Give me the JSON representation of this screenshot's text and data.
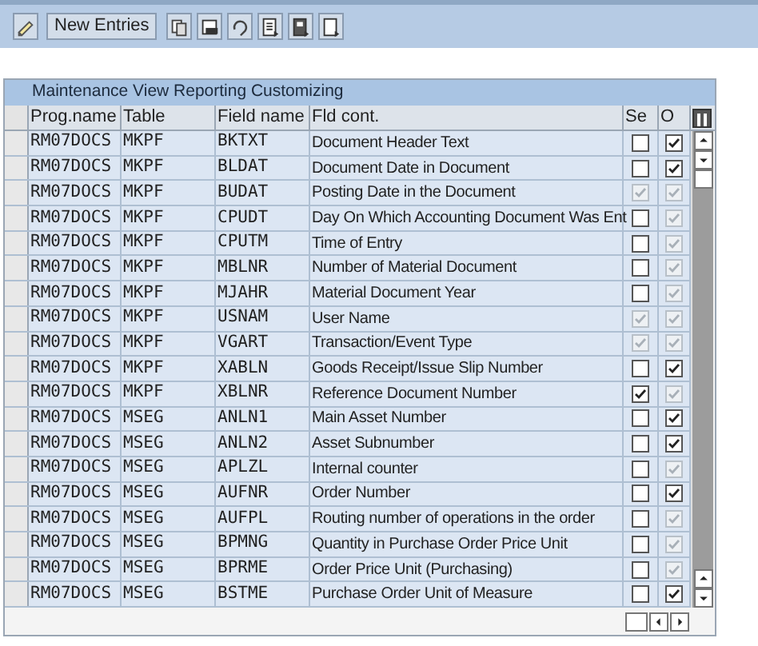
{
  "toolbar": {
    "new_entries_button": "New Entries"
  },
  "table": {
    "title": "Maintenance View Reporting Customizing",
    "columns": [
      "Prog.name",
      "Table",
      "Field name",
      "Fld cont.",
      "Se",
      "O"
    ],
    "rows": [
      {
        "prog": "RM07DOCS",
        "table": "MKPF",
        "field": "BKTXT",
        "content": "Document Header Text",
        "se": {
          "checked": false,
          "disabled": false
        },
        "o": {
          "checked": true,
          "disabled": false
        }
      },
      {
        "prog": "RM07DOCS",
        "table": "MKPF",
        "field": "BLDAT",
        "content": "Document Date in Document",
        "se": {
          "checked": false,
          "disabled": false
        },
        "o": {
          "checked": true,
          "disabled": false
        }
      },
      {
        "prog": "RM07DOCS",
        "table": "MKPF",
        "field": "BUDAT",
        "content": "Posting Date in the Document",
        "se": {
          "checked": true,
          "disabled": true
        },
        "o": {
          "checked": true,
          "disabled": true
        }
      },
      {
        "prog": "RM07DOCS",
        "table": "MKPF",
        "field": "CPUDT",
        "content": "Day On Which Accounting Document Was Ent",
        "se": {
          "checked": false,
          "disabled": false
        },
        "o": {
          "checked": true,
          "disabled": true
        }
      },
      {
        "prog": "RM07DOCS",
        "table": "MKPF",
        "field": "CPUTM",
        "content": "Time of Entry",
        "se": {
          "checked": false,
          "disabled": false
        },
        "o": {
          "checked": true,
          "disabled": true
        }
      },
      {
        "prog": "RM07DOCS",
        "table": "MKPF",
        "field": "MBLNR",
        "content": "Number of Material Document",
        "se": {
          "checked": false,
          "disabled": false
        },
        "o": {
          "checked": true,
          "disabled": true
        }
      },
      {
        "prog": "RM07DOCS",
        "table": "MKPF",
        "field": "MJAHR",
        "content": "Material Document Year",
        "se": {
          "checked": false,
          "disabled": false
        },
        "o": {
          "checked": true,
          "disabled": true
        }
      },
      {
        "prog": "RM07DOCS",
        "table": "MKPF",
        "field": "USNAM",
        "content": "User Name",
        "se": {
          "checked": true,
          "disabled": true
        },
        "o": {
          "checked": true,
          "disabled": true
        }
      },
      {
        "prog": "RM07DOCS",
        "table": "MKPF",
        "field": "VGART",
        "content": "Transaction/Event Type",
        "se": {
          "checked": true,
          "disabled": true
        },
        "o": {
          "checked": true,
          "disabled": true
        }
      },
      {
        "prog": "RM07DOCS",
        "table": "MKPF",
        "field": "XABLN",
        "content": "Goods Receipt/Issue Slip Number",
        "se": {
          "checked": false,
          "disabled": false
        },
        "o": {
          "checked": true,
          "disabled": false
        }
      },
      {
        "prog": "RM07DOCS",
        "table": "MKPF",
        "field": "XBLNR",
        "content": "Reference Document Number",
        "se": {
          "checked": true,
          "disabled": false
        },
        "o": {
          "checked": true,
          "disabled": true
        }
      },
      {
        "prog": "RM07DOCS",
        "table": "MSEG",
        "field": "ANLN1",
        "content": "Main Asset Number",
        "se": {
          "checked": false,
          "disabled": false
        },
        "o": {
          "checked": true,
          "disabled": false
        }
      },
      {
        "prog": "RM07DOCS",
        "table": "MSEG",
        "field": "ANLN2",
        "content": "Asset Subnumber",
        "se": {
          "checked": false,
          "disabled": false
        },
        "o": {
          "checked": true,
          "disabled": false
        }
      },
      {
        "prog": "RM07DOCS",
        "table": "MSEG",
        "field": "APLZL",
        "content": "Internal counter",
        "se": {
          "checked": false,
          "disabled": false
        },
        "o": {
          "checked": true,
          "disabled": true
        }
      },
      {
        "prog": "RM07DOCS",
        "table": "MSEG",
        "field": "AUFNR",
        "content": "Order Number",
        "se": {
          "checked": false,
          "disabled": false
        },
        "o": {
          "checked": true,
          "disabled": false
        }
      },
      {
        "prog": "RM07DOCS",
        "table": "MSEG",
        "field": "AUFPL",
        "content": "Routing number of operations in the order",
        "se": {
          "checked": false,
          "disabled": false
        },
        "o": {
          "checked": true,
          "disabled": true
        }
      },
      {
        "prog": "RM07DOCS",
        "table": "MSEG",
        "field": "BPMNG",
        "content": "Quantity in Purchase Order Price Unit",
        "se": {
          "checked": false,
          "disabled": false
        },
        "o": {
          "checked": true,
          "disabled": true
        }
      },
      {
        "prog": "RM07DOCS",
        "table": "MSEG",
        "field": "BPRME",
        "content": "Order Price Unit (Purchasing)",
        "se": {
          "checked": false,
          "disabled": false
        },
        "o": {
          "checked": true,
          "disabled": true
        }
      },
      {
        "prog": "RM07DOCS",
        "table": "MSEG",
        "field": "BSTME",
        "content": "Purchase Order Unit of Measure",
        "se": {
          "checked": false,
          "disabled": false
        },
        "o": {
          "checked": true,
          "disabled": false
        }
      }
    ]
  }
}
